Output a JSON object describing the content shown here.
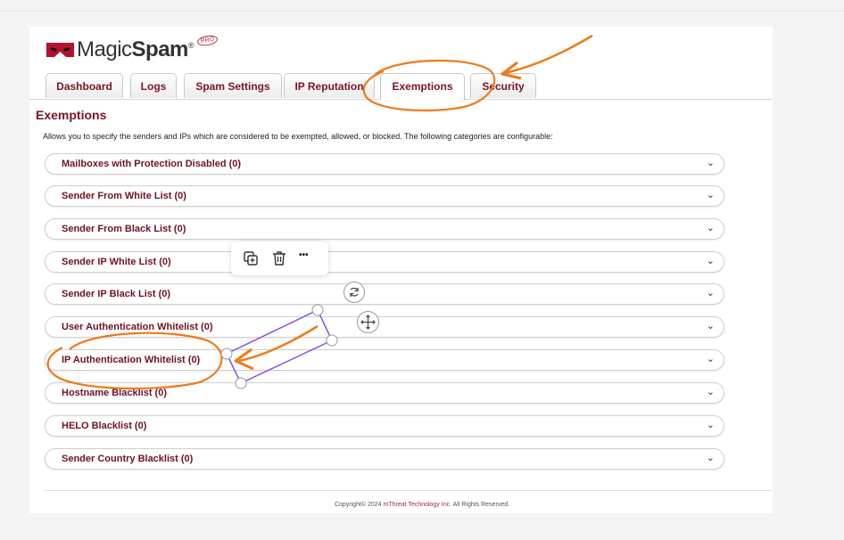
{
  "brand": {
    "name_part1": "Magic",
    "name_part2": "Spam",
    "badge": "PRO",
    "registered": "®"
  },
  "tabs": [
    {
      "label": "Dashboard"
    },
    {
      "label": "Logs"
    },
    {
      "label": "Spam Settings"
    },
    {
      "label": "IP Reputation"
    },
    {
      "label": "Exemptions",
      "active": true
    },
    {
      "label": "Security"
    }
  ],
  "page": {
    "title": "Exemptions",
    "description": "Allows you to specify the senders and IPs which are considered to be exempted, allowed, or blocked. The following categories are configurable:"
  },
  "categories": [
    {
      "label": "Mailboxes with Protection Disabled (0)"
    },
    {
      "label": "Sender From White List (0)"
    },
    {
      "label": "Sender From Black List (0)"
    },
    {
      "label": "Sender IP White List (0)"
    },
    {
      "label": "Sender IP Black List (0)"
    },
    {
      "label": "User Authentication Whitelist (0)"
    },
    {
      "label": "IP Authentication Whitelist (0)"
    },
    {
      "label": "Hostname Blacklist (0)"
    },
    {
      "label": "HELO Blacklist (0)"
    },
    {
      "label": "Sender Country Blacklist (0)"
    }
  ],
  "chevron": "⌄",
  "footer": {
    "prefix": "Copyright© 2024 ",
    "company": "mThreat Technology Inc",
    "suffix": ". All Rights Reserved."
  },
  "toolbar": {
    "icons": [
      "duplicate-icon",
      "trash-icon",
      "more-icon"
    ],
    "more_glyph": "•••"
  },
  "colors": {
    "brand_red": "#7a1428",
    "annotation_orange": "#f07a1a",
    "selection_purple": "#8a4ff0"
  }
}
